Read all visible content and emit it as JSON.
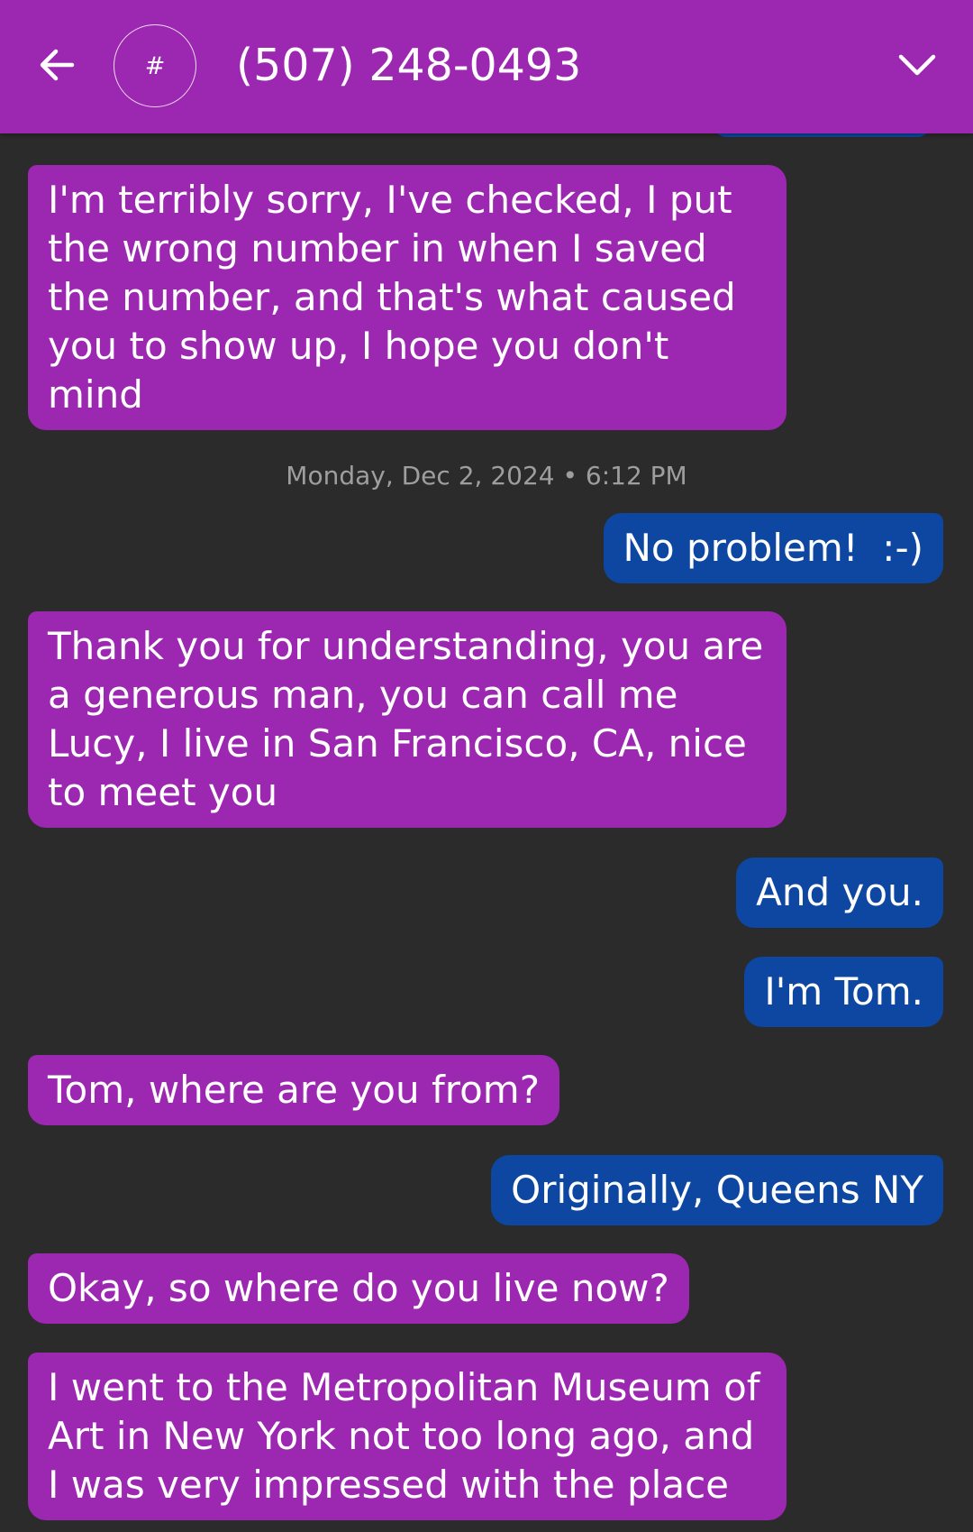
{
  "header": {
    "back_icon": "arrow-left-icon",
    "avatar_glyph": "#",
    "title": "(507) 248-0493",
    "menu_icon": "chevron-down-icon"
  },
  "colors": {
    "header": "#9c27b0",
    "incoming_bubble": "#9c27b0",
    "outgoing_bubble": "#0d47a1",
    "background": "#2b2b2b",
    "timestamp_text": "#9e9e9e"
  },
  "conversation": {
    "timestamp": "Monday, Dec 2, 2024 • 6:12 PM",
    "messages": [
      {
        "direction": "incoming",
        "text": "I'm terribly sorry, I've checked, I put\nthe wrong number in when I saved\nthe number, and that's what caused\nyou to show up, I hope you don't\nmind"
      },
      {
        "direction": "outgoing",
        "text": "No problem!  :-)"
      },
      {
        "direction": "incoming",
        "text": "Thank you for understanding, you are\na generous man, you can call me\nLucy, I live in San Francisco, CA, nice\nto meet you"
      },
      {
        "direction": "outgoing",
        "text": "And you."
      },
      {
        "direction": "outgoing",
        "text": "I'm Tom."
      },
      {
        "direction": "incoming",
        "text": "Tom, where are you from?"
      },
      {
        "direction": "outgoing",
        "text": "Originally, Queens NY"
      },
      {
        "direction": "incoming",
        "text": "Okay, so where do you live now?"
      },
      {
        "direction": "incoming",
        "text": "I went to the Metropolitan Museum of\nArt in New York not too long ago, and\nI was very impressed with the place"
      }
    ]
  }
}
